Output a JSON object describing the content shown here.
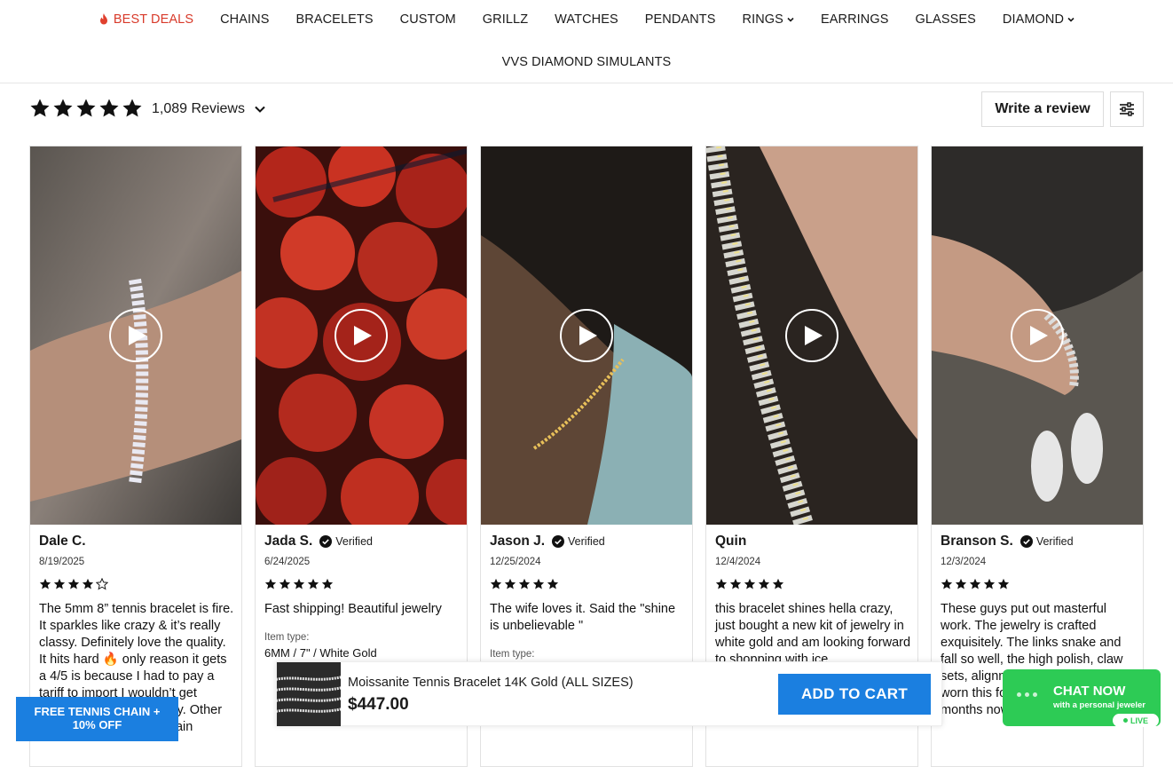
{
  "nav": {
    "row1": [
      {
        "label": "BEST DEALS",
        "icon": "flame-icon",
        "color": "#d83a2a"
      },
      {
        "label": "CHAINS"
      },
      {
        "label": "BRACELETS"
      },
      {
        "label": "CUSTOM"
      },
      {
        "label": "GRILLZ"
      },
      {
        "label": "WATCHES"
      },
      {
        "label": "PENDANTS"
      },
      {
        "label": "RINGS",
        "dropdown": true
      },
      {
        "label": "EARRINGS"
      },
      {
        "label": "GLASSES"
      },
      {
        "label": "DIAMOND",
        "dropdown": true
      }
    ],
    "row2": [
      {
        "label": "VVS DIAMOND SIMULANTS"
      }
    ]
  },
  "reviews_header": {
    "rating": 5,
    "count_label": "1,089 Reviews",
    "write_review_label": "Write a review",
    "star_color": "#111111"
  },
  "reviews": [
    {
      "author": "Dale C.",
      "verified": false,
      "date": "8/19/2025",
      "rating": 4,
      "text": "The 5mm 8” tennis bracelet is fire. It sparkles like crazy & it’s really classy. Definitely love the quality. It hits hard 🔥 only reason it gets a 4/5 is because I had to pay a tariff to import I wouldn’t get anywhere else my quality. Other than that I would buy again"
    },
    {
      "author": "Jada S.",
      "verified": true,
      "verified_label": "Verified",
      "date": "6/24/2025",
      "rating": 5,
      "text": "Fast shipping! Beautiful jewelry",
      "item_type_label": "Item type:",
      "item_type": "6MM / 7\" / White Gold"
    },
    {
      "author": "Jason J.",
      "verified": true,
      "verified_label": "Verified",
      "date": "12/25/2024",
      "rating": 5,
      "text": "The wife loves it. Said the \"shine is unbelievable \"",
      "item_type_label": "Item type:"
    },
    {
      "author": "Quin",
      "verified": false,
      "date": "12/4/2024",
      "rating": 5,
      "text": "this bracelet shines hella crazy, just bought a new kit of jewelry in white gold and am looking forward to shopping with ice"
    },
    {
      "author": "Branson S.",
      "verified": true,
      "verified_label": "Verified",
      "date": "12/3/2024",
      "rating": 5,
      "text": "These guys put out masterful work. The jewelry is crafted exquisitely. The links snake and fall so well, the high polish, claw sets, alignment of stones. I’ve worn this for more than a few months now,"
    }
  ],
  "sticky_bar": {
    "product_name": "Moissanite Tennis Bracelet 14K Gold (ALL SIZES)",
    "price": "$447.00",
    "add_to_cart_label": "ADD TO CART",
    "button_color": "#1b7fe0"
  },
  "chat": {
    "title": "CHAT NOW",
    "subtitle": "with a personal jeweler",
    "live_label": "LIVE",
    "color": "#2dcb55"
  },
  "promo": {
    "line1": "FREE TENNIS CHAIN +",
    "line2": "10% OFF"
  }
}
